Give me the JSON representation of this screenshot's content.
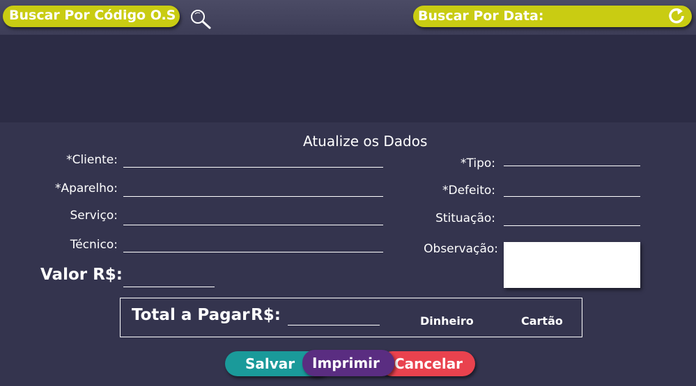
{
  "header": {
    "search_code_label": "Buscar Por Código O.S",
    "search_date_label": "Buscar Por Data:"
  },
  "form": {
    "title": "Atualize os Dados",
    "cliente_label": "*Cliente:",
    "aparelho_label": "*Aparelho:",
    "servico_label": "Serviço:",
    "tecnico_label": "Técnico:",
    "tipo_label": "*Tipo:",
    "defeito_label": "*Defeito:",
    "situacao_label": "Stituação:",
    "observacao_label": "Observação:",
    "valor_label": "Valor R$:"
  },
  "payment": {
    "total_label": "Total a Pagar",
    "currency_label": "R$:",
    "dinheiro_label": "Dinheiro",
    "cartao_label": "Cartão"
  },
  "actions": {
    "save_label": "Salvar",
    "print_label": "Imprimir",
    "cancel_label": "Cancelar"
  },
  "colors": {
    "background": "#30304a",
    "accent_yellow": "#c9cc12",
    "save": "#1a9a9a",
    "print": "#5a2d81",
    "cancel": "#e9424e"
  },
  "icons": {
    "search": "search-icon",
    "refresh": "refresh-icon"
  }
}
